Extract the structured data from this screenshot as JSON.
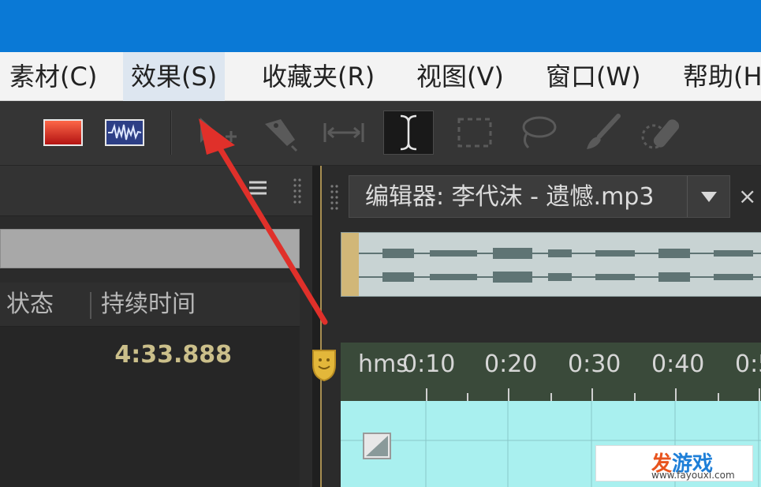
{
  "menubar": {
    "items": [
      {
        "label": "素材(C)"
      },
      {
        "label": "效果(S)",
        "active": true
      },
      {
        "label": "收藏夹(R)"
      },
      {
        "label": "视图(V)"
      },
      {
        "label": "窗口(W)"
      },
      {
        "label": "帮助(H"
      }
    ]
  },
  "toolbar": {
    "icons": [
      "spectral-frequency-icon",
      "waveform-icon",
      "move-tool-icon",
      "razor-tool-icon",
      "slip-tool-icon",
      "time-selection-tool-icon",
      "marquee-selection-icon",
      "lasso-selection-icon",
      "paintbrush-icon",
      "spot-healing-icon"
    ],
    "selected": "time-selection-tool-icon"
  },
  "files_panel": {
    "columns": [
      "状态",
      "持续时间"
    ],
    "rows": [
      {
        "status": "",
        "duration": "4:33.888"
      }
    ]
  },
  "editor": {
    "title": "编辑器: 李代沫 - 遗憾.mp3",
    "ruler": {
      "unit_label": "hms",
      "ticks": [
        "0:10",
        "0:20",
        "0:30",
        "0:40",
        "0:5"
      ]
    }
  },
  "watermark": {
    "title_first": "发",
    "title_rest": "游戏",
    "url": "www.fayouxi.com"
  },
  "colors": {
    "titlebar": "#0a79d6",
    "annotation_arrow": "#e0302a",
    "waveform_bg": "#a9f0ef",
    "playhead": "#e3b73a"
  }
}
